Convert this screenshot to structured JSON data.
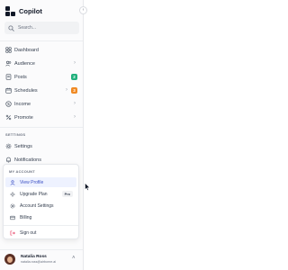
{
  "app": {
    "name": "Copilot",
    "collapse_icon": "chevron-left-icon"
  },
  "search": {
    "placeholder": "Search..."
  },
  "nav": {
    "dashboard": {
      "label": "Dashboard",
      "icon": "grid-icon"
    },
    "audience": {
      "label": "Audience",
      "icon": "users-icon"
    },
    "posts": {
      "label": "Posts",
      "icon": "posts-icon",
      "badge": "2",
      "badge_color": "#22b07d"
    },
    "schedules": {
      "label": "Schedules",
      "icon": "calendar-icon",
      "badge": "3",
      "badge_color": "#f08a24"
    },
    "income": {
      "label": "Income",
      "icon": "income-icon"
    },
    "promote": {
      "label": "Promote",
      "icon": "percent-icon"
    }
  },
  "settings_section": {
    "label": "SETTINGS",
    "settings": {
      "label": "Settings",
      "icon": "gear-icon"
    },
    "notifications": {
      "label": "Notifications",
      "icon": "bell-icon"
    }
  },
  "account_menu": {
    "header": "MY ACCOUNT",
    "view_profile": "View Profile",
    "upgrade_plan": "Upgrade Plan",
    "upgrade_tag": "Pro",
    "account_settings": "Account Settings",
    "billing": "Billing",
    "sign_out": "Sign out"
  },
  "profile": {
    "name": "Natalia Ross",
    "email": "natalia.ross@airborne.ai"
  },
  "colors": {
    "accent": "#3b4fc4",
    "sidebar_bg": "#fbfbfc",
    "active_bg": "#eef2ff",
    "signout_icon": "#e11d48"
  }
}
